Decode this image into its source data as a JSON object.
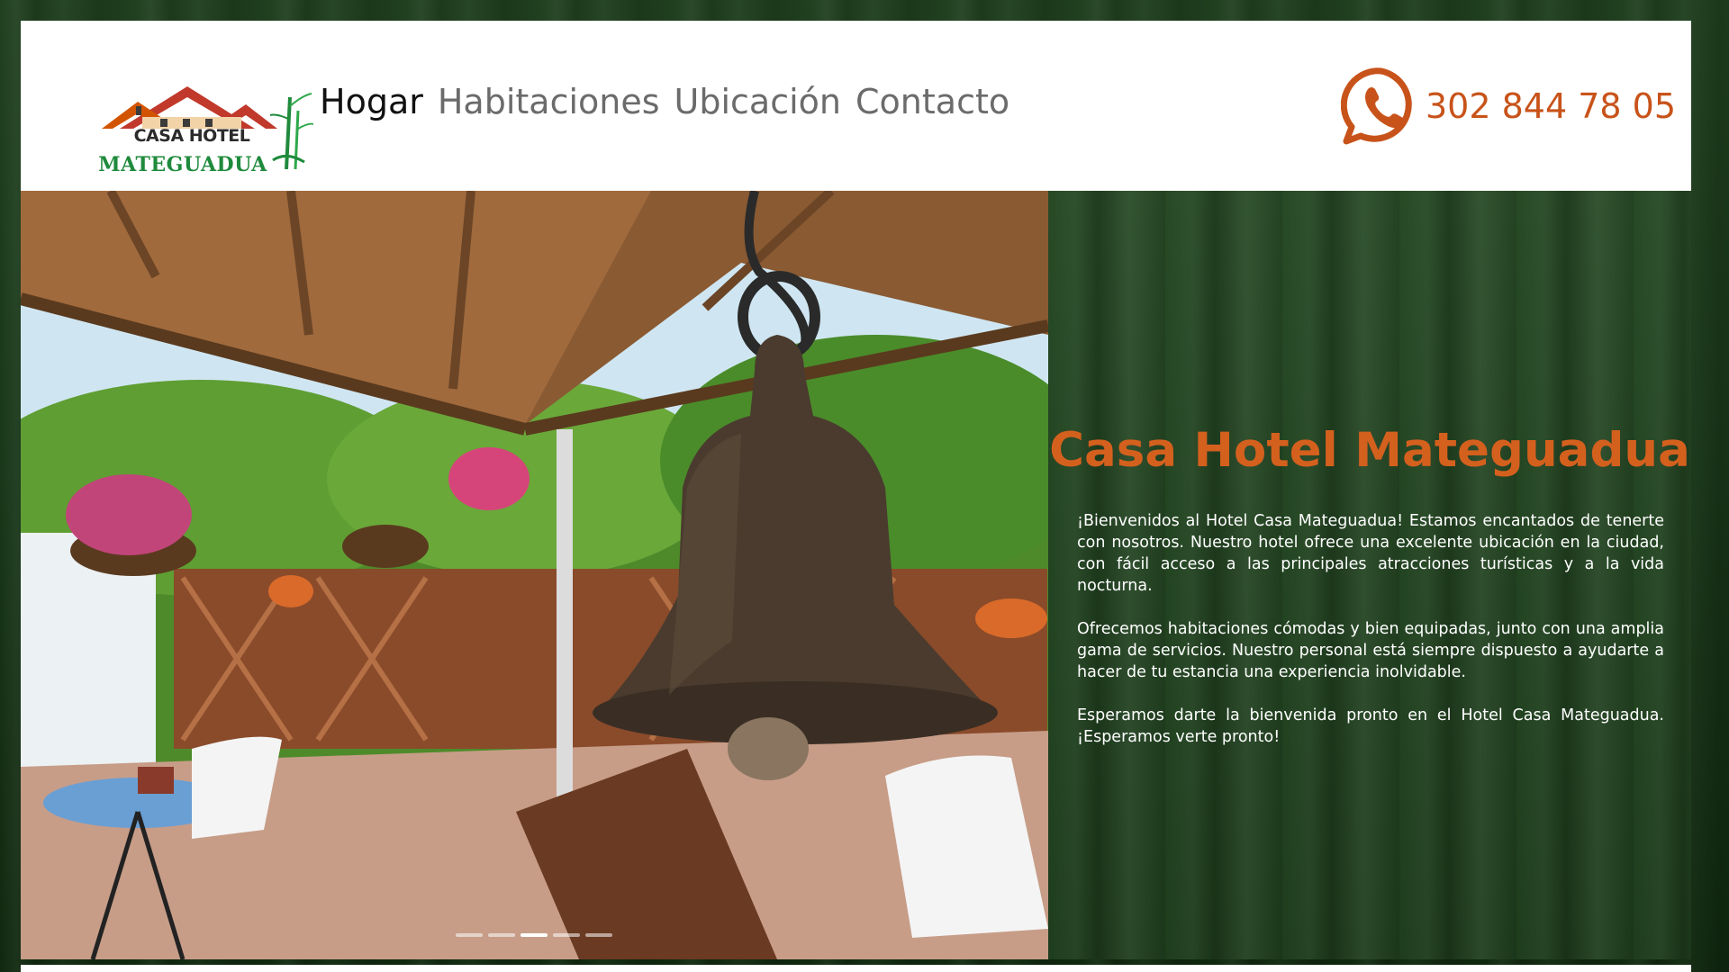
{
  "brand": {
    "logo_line1": "CASA HOTEL",
    "logo_line2": "MATEGUADUA"
  },
  "nav": {
    "items": [
      {
        "label": "Hogar",
        "active": true
      },
      {
        "label": "Habitaciones",
        "active": false
      },
      {
        "label": "Ubicación",
        "active": false
      },
      {
        "label": "Contacto",
        "active": false
      }
    ]
  },
  "contact": {
    "icon": "whatsapp-icon",
    "phone": "302 844 78 05"
  },
  "hero": {
    "carousel_count": 5,
    "active_index": 2
  },
  "intro": {
    "title": "Casa Hotel Mateguadua",
    "paragraphs": [
      "¡Bienvenidos al Hotel Casa Mateguadua! Estamos encantados de tenerte con nosotros. Nuestro hotel ofrece una excelente ubicación en la ciudad, con fácil acceso a las principales atracciones turísticas y a la vida nocturna.",
      "Ofrecemos habitaciones cómodas y bien equipadas, junto con una amplia gama de servicios. Nuestro personal está siempre dispuesto a ayudarte a hacer de tu estancia una experiencia inolvidable.",
      "Esperamos darte la bienvenida pronto en el Hotel Casa Mateguadua. ¡Esperamos verte pronto!"
    ]
  },
  "colors": {
    "accent": "#d4601e",
    "phone": "#c8531a",
    "logo_green": "#1f8a3c",
    "logo_roof": "#c0392b",
    "panel_bg": "#1e3d1d"
  }
}
